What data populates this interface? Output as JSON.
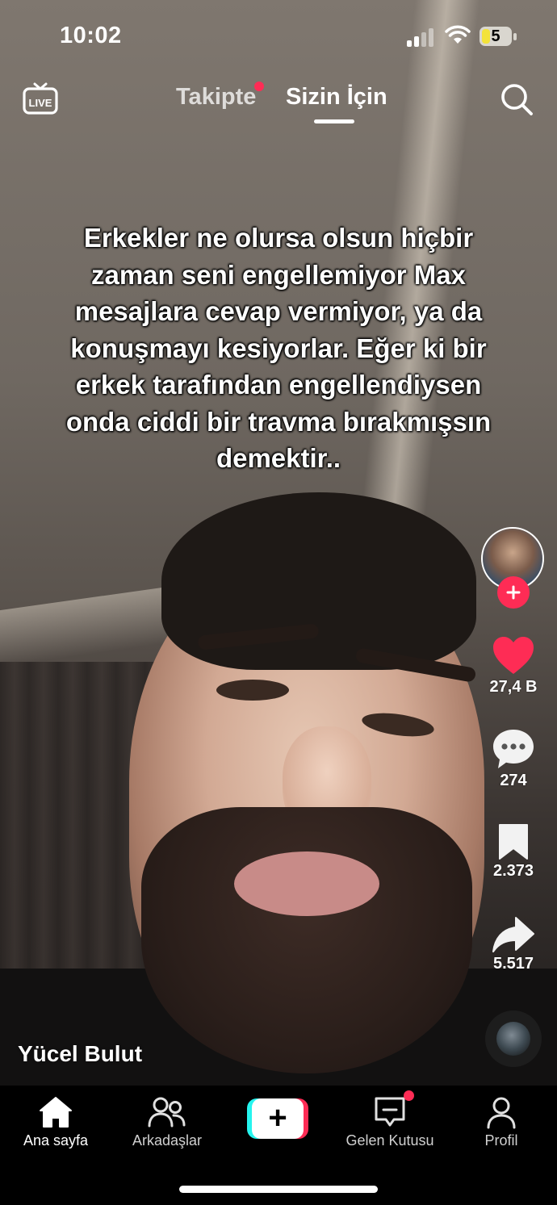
{
  "status_bar": {
    "time": "10:02",
    "battery_level": "5"
  },
  "top_nav": {
    "live_icon": "live-tv-icon",
    "tabs": [
      {
        "label": "Takipte",
        "active": false,
        "has_notification_dot": true
      },
      {
        "label": "Sizin İçin",
        "active": true
      }
    ],
    "search_icon": "search-icon"
  },
  "caption": {
    "lines": [
      "Erkekler ne olursa olsun hiçbir",
      "zaman seni engellemiyor Max",
      "mesajlara cevap vermiyor, ya da",
      "konuşmayı kesiyorlar. Eğer ki bir",
      "erkek tarafından engellendiysen",
      "onda ciddi bir travma bırakmışsın",
      "demektir.."
    ]
  },
  "right_rail": {
    "like_count": "27,4 B",
    "comment_count": "274",
    "bookmark_count": "2.373",
    "share_count": "5.517"
  },
  "author": {
    "name": "Yücel Bulut"
  },
  "bottom_nav": {
    "items": [
      {
        "label": "Ana sayfa",
        "icon": "home-icon",
        "active": true
      },
      {
        "label": "Arkadaşlar",
        "icon": "friends-icon"
      },
      {
        "label": "",
        "icon": "create-plus-icon"
      },
      {
        "label": "Gelen Kutusu",
        "icon": "inbox-icon",
        "has_notification_dot": true
      },
      {
        "label": "Profil",
        "icon": "profile-icon"
      }
    ]
  },
  "colors": {
    "accent": "#fe2c55",
    "cyan": "#25f4ee",
    "battery_fill": "#f3e33a"
  }
}
